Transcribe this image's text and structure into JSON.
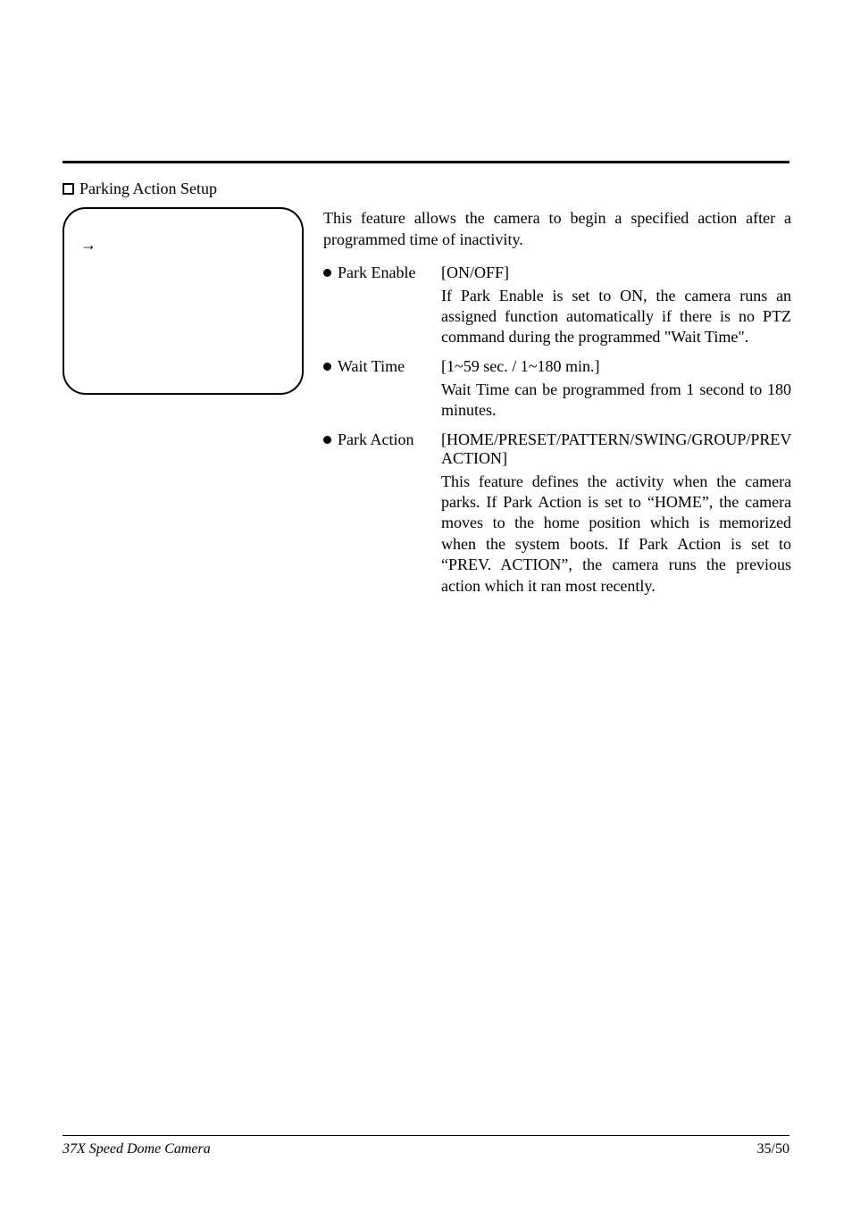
{
  "section_heading": "Parking Action Setup",
  "sidebox_arrow": "→",
  "intro": "This feature allows the camera to begin a specified action after a programmed time of inactivity.",
  "items": [
    {
      "label": "Park Enable",
      "value": "[ON/OFF]",
      "desc": "If Park Enable is set to ON, the camera runs an assigned function automatically if there is no PTZ command during the programmed \"Wait Time\"."
    },
    {
      "label": "Wait Time",
      "value": "[1~59 sec. / 1~180 min.]",
      "desc": "Wait Time can be programmed from 1 second to 180 minutes."
    },
    {
      "label": "Park Action",
      "value": "[HOME/PRESET/PATTERN/SWING/GROUP/PREV ACTION]",
      "desc": "This feature defines the activity when the camera parks. If Park Action is set to “HOME”, the camera moves to the home position which is memorized when the system boots. If Park Action is set to “PREV. ACTION”, the camera runs the previous action which it ran most recently."
    }
  ],
  "footer": {
    "left": "37X Speed Dome Camera",
    "right": "35/50"
  }
}
